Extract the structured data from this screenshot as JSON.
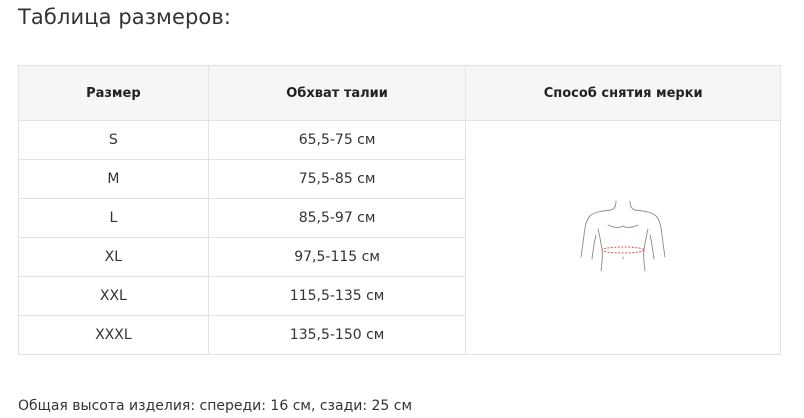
{
  "page": {
    "title": "Таблица размеров:",
    "footnote": "Общая высота изделия: спереди: 16 см, сзади: 25 см"
  },
  "table": {
    "headers": [
      "Размер",
      "Обхват талии",
      "Способ снятия мерки"
    ],
    "rows": [
      {
        "size": "S",
        "waist": "65,5-75 см"
      },
      {
        "size": "M",
        "waist": "75,5-85 см"
      },
      {
        "size": "L",
        "waist": "85,5-97 см"
      },
      {
        "size": "XL",
        "waist": "97,5-115 см"
      },
      {
        "size": "XXL",
        "waist": "115,5-135 см"
      },
      {
        "size": "XXXL",
        "waist": "135,5-150 см"
      }
    ],
    "figure_icon": "torso-waist-measure-icon"
  },
  "colors": {
    "header_bg": "#f5f7f7",
    "border": "#e3e3e3",
    "measure_line": "#d9534f"
  }
}
